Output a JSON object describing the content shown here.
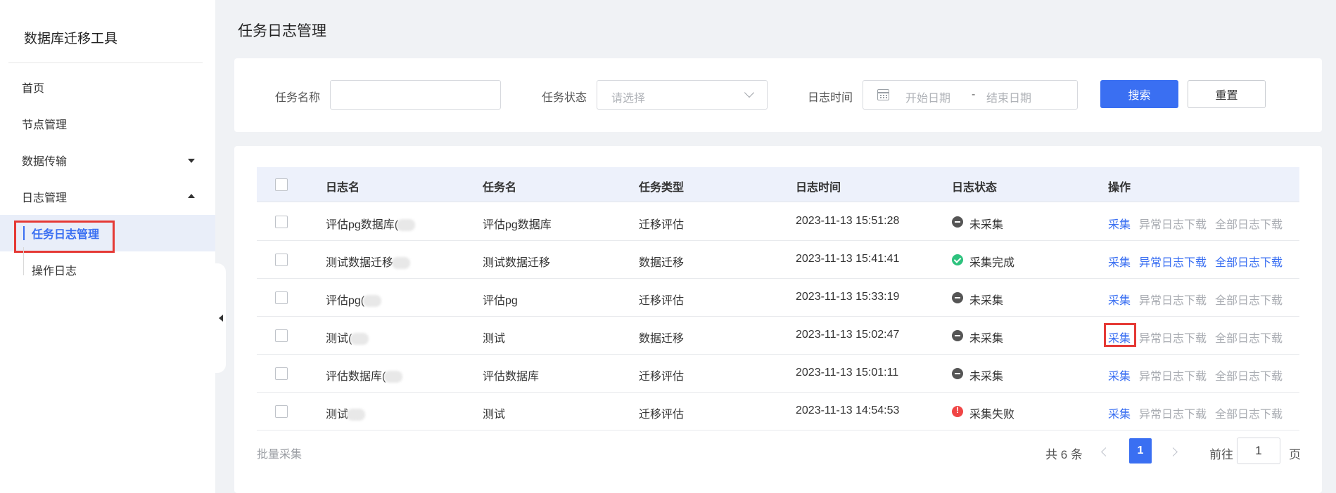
{
  "app": {
    "title": "数据库迁移工具"
  },
  "sidebar": {
    "items": [
      {
        "label": "首页"
      },
      {
        "label": "节点管理"
      },
      {
        "label": "数据传输"
      },
      {
        "label": "日志管理"
      }
    ],
    "sub_items": [
      {
        "label": "任务日志管理",
        "active": true
      },
      {
        "label": "操作日志"
      }
    ]
  },
  "page": {
    "title": "任务日志管理"
  },
  "filters": {
    "task_name_label": "任务名称",
    "task_name_value": "",
    "task_status_label": "任务状态",
    "task_status_placeholder": "请选择",
    "log_time_label": "日志时间",
    "start_placeholder": "开始日期",
    "range_separator": "-",
    "end_placeholder": "结束日期",
    "search_label": "搜索",
    "reset_label": "重置"
  },
  "table": {
    "headers": [
      "日志名",
      "任务名",
      "任务类型",
      "日志时间",
      "日志状态",
      "操作"
    ],
    "action_labels": {
      "collect": "采集",
      "error_download": "异常日志下载",
      "all_download": "全部日志下载"
    },
    "rows": [
      {
        "log_name": "评估pg数据库(",
        "task_name": "评估pg数据库",
        "task_type": "迁移评估",
        "log_time": "2023-11-13 15:51:28",
        "status": "未采集",
        "status_kind": "pending"
      },
      {
        "log_name": "测试数据迁移",
        "task_name": "测试数据迁移",
        "task_type": "数据迁移",
        "log_time": "2023-11-13 15:41:41",
        "status": "采集完成",
        "status_kind": "done"
      },
      {
        "log_name": "评估pg(",
        "task_name": "评估pg",
        "task_type": "迁移评估",
        "log_time": "2023-11-13 15:33:19",
        "status": "未采集",
        "status_kind": "pending"
      },
      {
        "log_name": "测试(",
        "task_name": "测试",
        "task_type": "数据迁移",
        "log_time": "2023-11-13 15:02:47",
        "status": "未采集",
        "status_kind": "pending"
      },
      {
        "log_name": "评估数据库(",
        "task_name": "评估数据库",
        "task_type": "迁移评估",
        "log_time": "2023-11-13 15:01:11",
        "status": "未采集",
        "status_kind": "pending"
      },
      {
        "log_name": "测试",
        "task_name": "测试",
        "task_type": "迁移评估",
        "log_time": "2023-11-13 14:54:53",
        "status": "采集失败",
        "status_kind": "fail"
      }
    ]
  },
  "footer": {
    "batch_label": "批量采集",
    "total_label": "共 6 条",
    "current_page": "1",
    "goto_label": "前往",
    "goto_value": "1",
    "page_unit": "页"
  },
  "colors": {
    "accent": "#3a6ff2",
    "highlight": "#e53935",
    "done": "#2ec27e",
    "fail": "#f04545"
  }
}
